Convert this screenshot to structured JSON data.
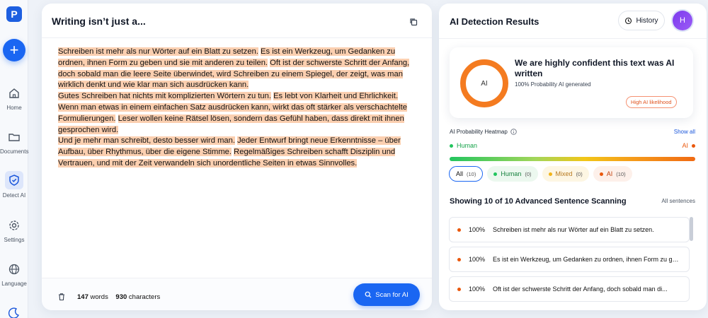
{
  "sidebar": {
    "logo": "P",
    "items": [
      {
        "label": "Home",
        "icon": "home-icon"
      },
      {
        "label": "Documents",
        "icon": "folder-icon"
      },
      {
        "label": "Detect AI",
        "icon": "shield-icon"
      },
      {
        "label": "Settings",
        "icon": "gear-icon"
      },
      {
        "label": "Language",
        "icon": "globe-icon"
      }
    ]
  },
  "editor": {
    "title": "Writing isn’t just a...",
    "paragraphs": [
      [
        "Schreiben ist mehr als nur Wörter auf ein Blatt zu setzen.",
        "Es ist ein Werkzeug, um Gedanken zu ordnen, ihnen Form zu geben und sie mit anderen zu teilen.",
        "Oft ist der schwerste Schritt der Anfang, doch sobald man die leere Seite überwindet, wird Schreiben zu einem Spiegel, der zeigt, was man wirklich denkt und wie klar man sich ausdrücken kann."
      ],
      [
        "Gutes Schreiben hat nichts mit komplizierten Wörtern zu tun.",
        "Es lebt von Klarheit und Ehrlichkeit.",
        "Wenn man etwas in einem einfachen Satz ausdrücken kann, wirkt das oft stärker als verschachtelte Formulierungen.",
        "Leser wollen keine Rätsel lösen, sondern das Gefühl haben, dass direkt mit ihnen gesprochen wird."
      ],
      [
        "Und je mehr man schreibt, desto besser wird man.",
        "Jeder Entwurf bringt neue Erkenntnisse – über Aufbau, über Rhythmus, über die eigene Stimme.",
        "Regelmäßiges Schreiben schafft Disziplin und Vertrauen, und mit der Zeit verwandeln sich unordentliche Seiten in etwas Sinnvolles."
      ]
    ],
    "word_count": "147",
    "words_label": "words",
    "char_count": "930",
    "chars_label": "characters",
    "scan_label": "Scan for AI"
  },
  "results": {
    "title": "AI Detection Results",
    "history_label": "History",
    "avatar_initial": "H",
    "summary": {
      "donut_label": "AI",
      "headline": "We are highly confident this text was AI written",
      "probability_text": "100% Probability AI generated",
      "badge": "High AI likelihood",
      "ai_fraction": 1.0
    },
    "heatmap": {
      "title": "AI Probability Heatmap",
      "show_all": "Show all",
      "human_label": "Human",
      "ai_label": "AI"
    },
    "filters": [
      {
        "label": "All",
        "count": "(10)"
      },
      {
        "label": "Human",
        "count": "(0)"
      },
      {
        "label": "Mixed",
        "count": "(0)"
      },
      {
        "label": "AI",
        "count": "(10)"
      }
    ],
    "scan_title": "Showing 10 of 10 Advanced Sentence Scanning",
    "all_sentences": "All sentences",
    "sentences": [
      {
        "pct": "100%",
        "text": "Schreiben ist mehr als nur Wörter auf ein Blatt zu setzen."
      },
      {
        "pct": "100%",
        "text": "Es ist ein Werkzeug, um Gedanken zu ordnen, ihnen Form zu ge..."
      },
      {
        "pct": "100%",
        "text": "Oft ist der schwerste Schritt der Anfang, doch sobald man di..."
      }
    ]
  },
  "colors": {
    "accent": "#1a66f2",
    "ai": "#f47b20",
    "human": "#22c55e",
    "highlight": "#fbcfb0"
  }
}
